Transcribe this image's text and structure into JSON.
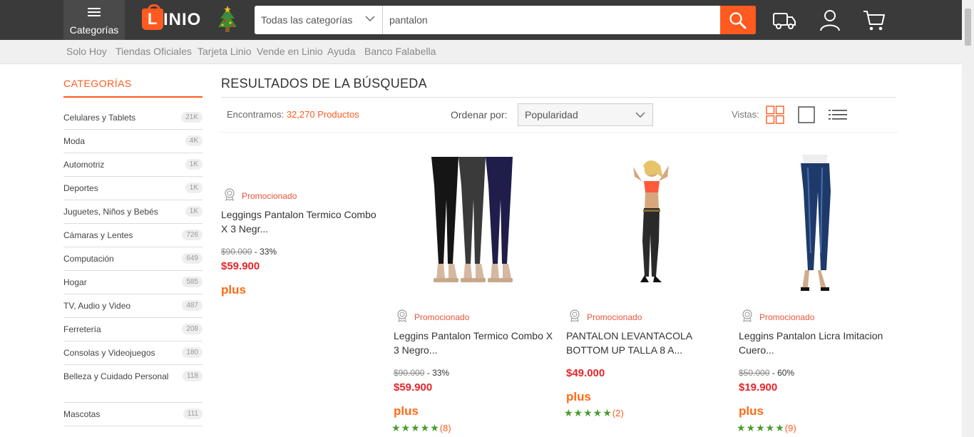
{
  "header": {
    "categories_label": "Categorías",
    "logo_text": "INIO",
    "logo_letter": "L",
    "search_category": "Todas las categorías",
    "search_value": "pantalon"
  },
  "subnav": [
    "Solo Hoy",
    "Tiendas Oficiales",
    "Tarjeta Linio",
    "Vende en Linio",
    "Ayuda",
    "Banco Falabella"
  ],
  "sidebar": {
    "title": "CATEGORÍAS",
    "items": [
      {
        "label": "Celulares y Tablets",
        "count": "21K"
      },
      {
        "label": "Moda",
        "count": "4K"
      },
      {
        "label": "Automotriz",
        "count": "1K"
      },
      {
        "label": "Deportes",
        "count": "1K"
      },
      {
        "label": "Juguetes, Niños y Bebés",
        "count": "1K"
      },
      {
        "label": "Cámaras y Lentes",
        "count": "726"
      },
      {
        "label": "Computación",
        "count": "649"
      },
      {
        "label": "Hogar",
        "count": "585"
      },
      {
        "label": "TV, Audio y Video",
        "count": "487"
      },
      {
        "label": "Ferretería",
        "count": "208"
      },
      {
        "label": "Consolas y Videojuegos",
        "count": "180"
      },
      {
        "label": "Belleza y Cuidado Personal",
        "count": "118"
      },
      {
        "label": "Mascotas",
        "count": "111"
      }
    ]
  },
  "results": {
    "title": "RESULTADOS DE LA BÚSQUEDA",
    "found_prefix": "Encontramos:",
    "found_count": "32,270 Productos",
    "sort_label": "Ordenar por:",
    "sort_value": "Popularidad",
    "views_label": "Vistas:"
  },
  "products": [
    {
      "promo": "Promocionado",
      "title": "Leggings Pantalon Termico Combo X 3 Negr...",
      "old_price": "$90.000",
      "discount": "- 33%",
      "price": "$59.900",
      "plus": "plus"
    },
    {
      "promo": "Promocionado",
      "title": "Leggins Pantalon Termico Combo X 3 Negro...",
      "old_price": "$90.000",
      "discount": "- 33%",
      "price": "$59.900",
      "plus": "plus",
      "stars": "★★★★★",
      "reviews": "(8)"
    },
    {
      "promo": "Promocionado",
      "title": "PANTALON LEVANTACOLA BOTTOM UP TALLA 8 A...",
      "price": "$49.000",
      "plus": "plus",
      "stars": "★★★★★",
      "reviews": "(2)"
    },
    {
      "promo": "Promocionado",
      "title": "Leggins Pantalon Licra Imitacion Cuero...",
      "old_price": "$50.000",
      "discount": "- 60%",
      "price": "$19.900",
      "plus": "plus",
      "stars": "★★★★★",
      "reviews": "(9)"
    }
  ],
  "colors": {
    "accent": "#ff5a1f",
    "price": "#e3262c",
    "stars": "#4b9b2e",
    "topbar": "#3a3a3a"
  }
}
